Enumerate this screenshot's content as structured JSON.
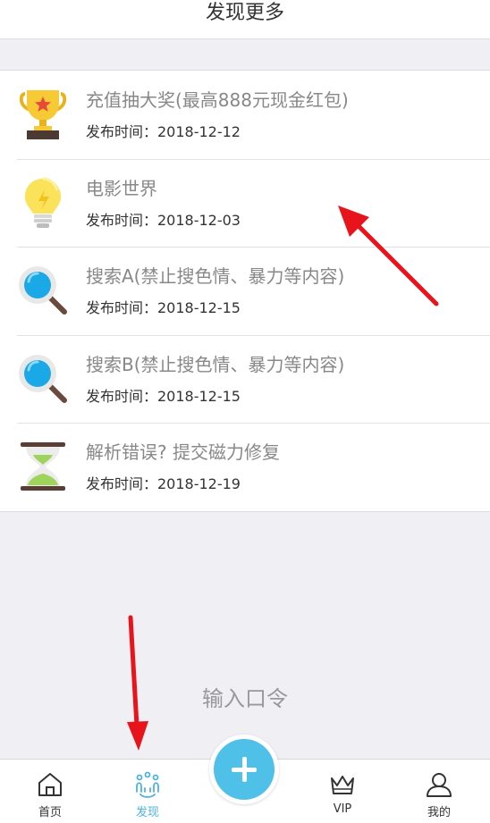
{
  "header": {
    "title": "发现更多"
  },
  "items": [
    {
      "title": "充值抽大奖(最高888元现金红包)",
      "date": "发布时间：2018-12-12",
      "icon": "trophy-icon"
    },
    {
      "title": "电影世界",
      "date": "发布时间：2018-12-03",
      "icon": "lightbulb-icon"
    },
    {
      "title": "搜索A(禁止搜色情、暴力等内容)",
      "date": "发布时间：2018-12-15",
      "icon": "search-icon"
    },
    {
      "title": "搜索B(禁止搜色情、暴力等内容)",
      "date": "发布时间：2018-12-15",
      "icon": "search-icon"
    },
    {
      "title": "解析错误? 提交磁力修复",
      "date": "发布时间：2018-12-19",
      "icon": "hourglass-icon"
    }
  ],
  "passcode": {
    "label": "输入口令"
  },
  "tabbar": {
    "home": "首页",
    "discover": "发现",
    "vip": "VIP",
    "mine": "我的",
    "active_color": "#4ab3e2",
    "accent": "#4fc0e8"
  }
}
